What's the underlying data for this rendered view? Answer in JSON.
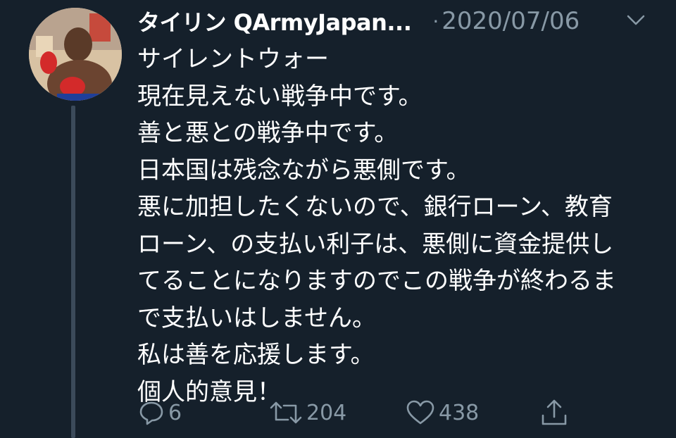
{
  "tweet": {
    "display_name": "タイリン QArmyJapan...",
    "date": "2020/07/06",
    "lines": [
      "サイレントウォー",
      "現在見えない戦争中です。",
      "善と悪との戦争中です。",
      "日本国は残念ながら悪側です。",
      "悪に加担したくないので、銀行ローン、教育",
      "ローン、の支払い利子は、悪側に資金提供し",
      "てることになりますのでこの戦争が終わるま",
      "で支払いはしません。",
      "私は善を応援します。",
      "個人的意見！"
    ],
    "actions": {
      "replies": "6",
      "retweets": "204",
      "likes": "438"
    }
  },
  "icons": {
    "reply": "reply-icon",
    "retweet": "retweet-icon",
    "like": "heart-icon",
    "share": "share-icon",
    "more": "chevron-down-icon"
  },
  "colors": {
    "background": "#15202b",
    "text": "#ffffff",
    "muted": "#8899a6"
  }
}
